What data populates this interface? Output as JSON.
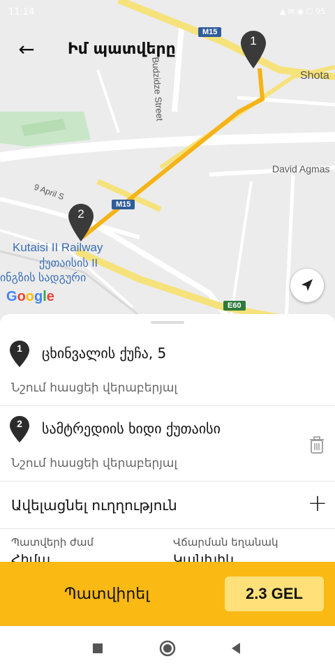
{
  "status_bar": {
    "time": "11:14",
    "system": "▲ ✉ ◉  ☐ 95"
  },
  "header": {
    "title": "Իմ պատվերը",
    "back_icon": "arrow-left-icon"
  },
  "map": {
    "labels": {
      "m15_top": "M15",
      "m15_mid": "M15",
      "e60": "E60",
      "budzidze": "Budzidze Street",
      "shota": "Shota",
      "david": "David Agmas",
      "april": "9 April S",
      "kutaisi_en": "Kutaisi II Railway",
      "kutaisi_ka1": "ქუთაისის II",
      "kutaisi_ka2": "ინგზის სადგური",
      "google": "Google"
    },
    "pins": [
      {
        "number": "1"
      },
      {
        "number": "2"
      }
    ],
    "route_color": "#f5b316",
    "locate_icon": "navigation-arrow-icon"
  },
  "stops": [
    {
      "number": "1",
      "address": "ცხინვალის ქუჩა, 5",
      "note": "Նշում հասցեի վերաբերյալ"
    },
    {
      "number": "2",
      "address": "სამტრედიის ხიდი ქუთაისი",
      "note": "Նշում հասցեի վերաբերյալ",
      "delete_icon": "trash-icon"
    }
  ],
  "add_direction": {
    "label": "Ավելացնել ուղղություն",
    "icon": "plus-icon"
  },
  "order_info": {
    "time_label": "Պատվերի ժամ",
    "time_value": "Հիմա",
    "payment_label": "Վճարման եղանակ",
    "payment_value": "Կանխիկ"
  },
  "order_button": {
    "label": "Պատվիրել",
    "price": "2.3 GEL",
    "color": "#fbb914"
  },
  "nav_bar": {
    "icons": [
      "square-recent-icon",
      "circle-home-icon",
      "triangle-back-icon"
    ]
  }
}
